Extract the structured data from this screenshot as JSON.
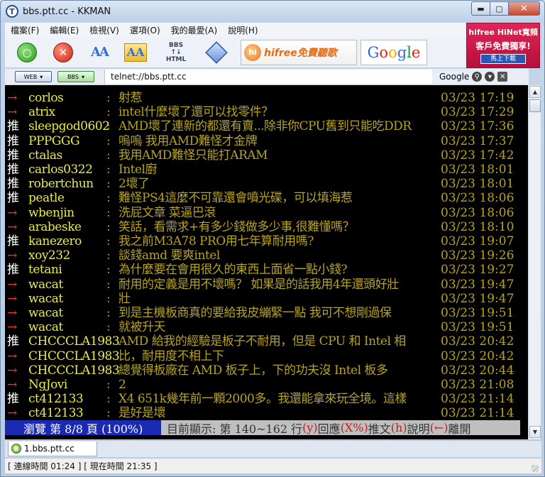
{
  "window": {
    "title": "bbs.ptt.cc - KKMAN",
    "app_icon_glyph": "T"
  },
  "window_controls": {
    "minimize": "▬",
    "maximize": "▢",
    "close": "✕"
  },
  "menu": [
    "檔案(F)",
    "編輯(E)",
    "檢視(V)",
    "選項(O)",
    "我的最愛(A)",
    "說明(H)"
  ],
  "toolbar": {
    "go_glyph": "○",
    "stop_glyph": "✕",
    "font_a": "AA",
    "font_b": "AA",
    "bbs_html": [
      "BBS",
      "↑↓",
      "HTML"
    ],
    "hifree_logo": "hi",
    "hifree_text": "hifree免費聽歌",
    "google_letters": [
      "G",
      "o",
      "o",
      "g",
      "l",
      "e"
    ]
  },
  "side_ad": {
    "line1": "hifree HiNet寬頻",
    "line2": "客戶免費獨享!",
    "button": "馬上下載"
  },
  "address_bar": {
    "web_label": "WEB",
    "bbs_label": "BBS",
    "url": "telnet://bbs.ptt.cc",
    "search_engine": "Google"
  },
  "colors": {
    "terminal_bg": "#000000",
    "user_id": "#eaea4c",
    "content": "#b7a31f",
    "push_tag": "#ffffff",
    "arrow_tag": "#ff3333",
    "status_blue": "#1a2ab2"
  },
  "comments": [
    {
      "tag": "→",
      "type": "arrow",
      "user": "corlos",
      "text": "射惹",
      "time": "03/23 17:19"
    },
    {
      "tag": "→",
      "type": "arrow",
      "user": "atrix",
      "text": "intel什麼壞了還可以找零件？",
      "time": "03/23 17:29"
    },
    {
      "tag": "推",
      "type": "push",
      "user": "sleepgod0602",
      "text": "AMD壞了連新的都還有賣...除非你CPU舊到只能吃DDR",
      "time": "03/23 17:36"
    },
    {
      "tag": "推",
      "type": "push",
      "user": "PPPGGG",
      "text": "嗚嗚 我用AMD難怪才金牌",
      "time": "03/23 17:37"
    },
    {
      "tag": "推",
      "type": "push",
      "user": "ctalas",
      "text": "我用AMD難怪只能打ARAM",
      "time": "03/23 17:42"
    },
    {
      "tag": "推",
      "type": "push",
      "user": "carlos0322",
      "text": "Intel廚",
      "time": "03/23 18:01"
    },
    {
      "tag": "推",
      "type": "push",
      "user": "robertchun",
      "text": "2壞了",
      "time": "03/23 18:01"
    },
    {
      "tag": "推",
      "type": "push",
      "user": "peatle",
      "text": "難怪PS4這麼不可靠還會噴光碟，可以填海惹",
      "time": "03/23 18:06"
    },
    {
      "tag": "→",
      "type": "arrow",
      "user": "wbenjin",
      "text": "洗屁文章 菜逼巴滾",
      "time": "03/23 18:06"
    },
    {
      "tag": "→",
      "type": "arrow",
      "user": "arabeske",
      "text": "笑話，看需求+有多少錢做多少事,很難懂嗎？",
      "time": "03/23 18:10"
    },
    {
      "tag": "推",
      "type": "push",
      "user": "kanezero",
      "text": "我之前M3A78 PRO用七年算耐用嗎?",
      "time": "03/23 19:07"
    },
    {
      "tag": "→",
      "type": "arrow",
      "user": "xoy232",
      "text": "談錢amd 要爽intel",
      "time": "03/23 19:26"
    },
    {
      "tag": "推",
      "type": "push",
      "user": "tetani",
      "text": "為什麼要在會用很久的東西上面省一點小錢?",
      "time": "03/23 19:27"
    },
    {
      "tag": "→",
      "type": "arrow",
      "user": "wacat",
      "text": "耐用的定義是用不壞嗎？ 如果是的話我用4年還頭好壯",
      "time": "03/23 19:47"
    },
    {
      "tag": "→",
      "type": "arrow",
      "user": "wacat",
      "text": "壯",
      "time": "03/23 19:47"
    },
    {
      "tag": "→",
      "type": "arrow",
      "user": "wacat",
      "text": "到是主機板商真的要給我皮繃緊一點 我可不想剛過保",
      "time": "03/23 19:51"
    },
    {
      "tag": "→",
      "type": "arrow",
      "user": "wacat",
      "text": "就被升天",
      "time": "03/23 19:51"
    },
    {
      "tag": "推",
      "type": "push",
      "user": "CHCCCLA1983",
      "text": "AMD 給我的經驗是板子不耐用，但是 CPU 和 Intel 相",
      "time": "03/23 20:42"
    },
    {
      "tag": "→",
      "type": "arrow",
      "user": "CHCCCLA1983",
      "text": "比，耐用度不相上下",
      "time": "03/23 20:42"
    },
    {
      "tag": "→",
      "type": "arrow",
      "user": "CHCCCLA1983",
      "text": "總覺得板廠在 AMD 板子上，下的功夫沒 Intel 板多",
      "time": "03/23 20:44"
    },
    {
      "tag": "→",
      "type": "arrow",
      "user": "NgJovi",
      "text": "2",
      "time": "03/23 21:08"
    },
    {
      "tag": "推",
      "type": "push",
      "user": "ct412133",
      "text": "X4 651k幾年前一顆2000多。我還能拿來玩全境。這樣",
      "time": "03/23 21:14"
    },
    {
      "tag": "→",
      "type": "arrow",
      "user": "ct412133",
      "text": "是好是壞",
      "time": "03/23 21:14"
    }
  ],
  "status_line": {
    "left": "瀏覽 第 8/8 頁 (100%)",
    "right_prefix": "目前顯示: 第 140~162 行",
    "keys": [
      {
        "key": "(y)",
        "label": "回應"
      },
      {
        "key": "(X%)",
        "label": "推文"
      },
      {
        "key": "(h)",
        "label": "說明"
      },
      {
        "key": "(←)",
        "label": "離開"
      }
    ]
  },
  "scrollbar": {
    "up": "▲",
    "down": "▼"
  },
  "tab": {
    "label": "1.bbs.ptt.cc",
    "icon_glyph": "B"
  },
  "statusbar": {
    "text": "[ 連線時間 01:24 ] [ 現在時間 21:35 ]"
  }
}
